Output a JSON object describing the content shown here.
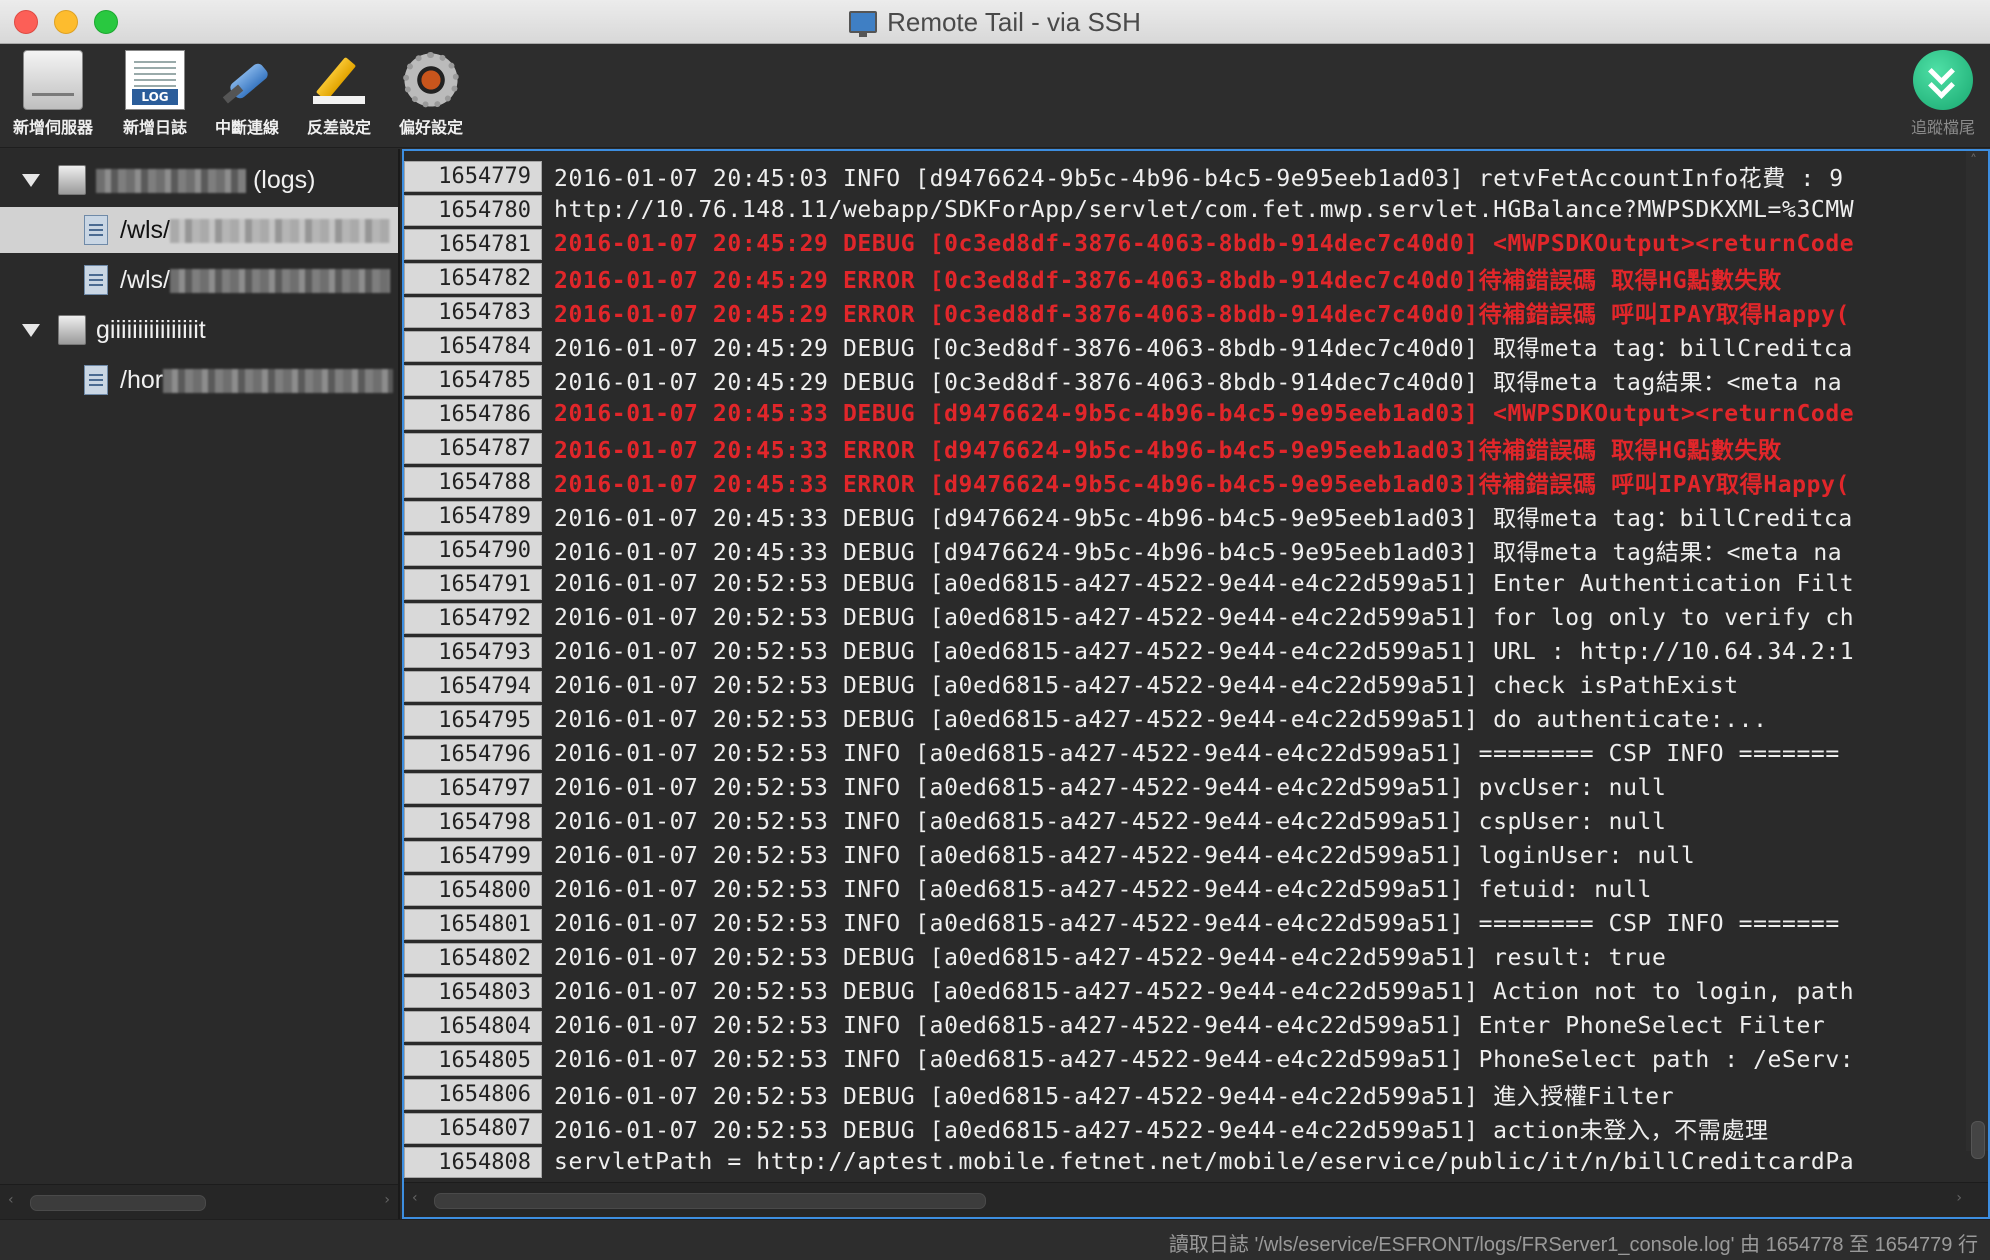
{
  "window": {
    "title": "Remote Tail - via SSH"
  },
  "toolbar": {
    "items": [
      {
        "label": "新增伺服器",
        "icon": "server-icon"
      },
      {
        "label": "新增日誌",
        "icon": "log-file-icon"
      },
      {
        "label": "中斷連線",
        "icon": "plug-disconnect-icon"
      },
      {
        "label": "反差設定",
        "icon": "highlighter-icon"
      },
      {
        "label": "偏好設定",
        "icon": "gear-icon"
      }
    ],
    "tail": {
      "label": "追蹤檔尾",
      "icon": "tail-down-icon"
    }
  },
  "sidebar": {
    "items": [
      {
        "type": "server",
        "text": " (logs)",
        "expanded": true
      },
      {
        "type": "log",
        "text": "/wls/",
        "selected": true
      },
      {
        "type": "log",
        "text": "/wls/"
      },
      {
        "type": "server",
        "text": "giiiiiiiiiiiiiiiit",
        "expanded": true
      },
      {
        "type": "log",
        "text": "/hor"
      }
    ]
  },
  "log": {
    "rows": [
      {
        "n": "1654779",
        "text": "2016-01-07 20:45:03 INFO [d9476624-9b5c-4b96-b4c5-9e95eeb1ad03] retvFetAccountInfo花費 : 9",
        "level": "info"
      },
      {
        "n": "1654780",
        "text": "http://10.76.148.11/webapp/SDKForApp/servlet/com.fet.mwp.servlet.HGBalance?MWPSDKXML=%3CMW",
        "level": "info"
      },
      {
        "n": "1654781",
        "text": "2016-01-07 20:45:29 DEBUG [0c3ed8df-3876-4063-8bdb-914dec7c40d0] <MWPSDKOutput><returnCode",
        "level": "error"
      },
      {
        "n": "1654782",
        "text": "2016-01-07 20:45:29 ERROR [0c3ed8df-3876-4063-8bdb-914dec7c40d0]待補錯誤碼 取得HG點數失敗",
        "level": "error"
      },
      {
        "n": "1654783",
        "text": "2016-01-07 20:45:29 ERROR [0c3ed8df-3876-4063-8bdb-914dec7c40d0]待補錯誤碼 呼叫IPAY取得Happy(",
        "level": "error"
      },
      {
        "n": "1654784",
        "text": "2016-01-07 20:45:29 DEBUG [0c3ed8df-3876-4063-8bdb-914dec7c40d0] 取得meta tag：billCreditca",
        "level": "info"
      },
      {
        "n": "1654785",
        "text": "2016-01-07 20:45:29 DEBUG [0c3ed8df-3876-4063-8bdb-914dec7c40d0] 取得meta tag結果：<meta na",
        "level": "info"
      },
      {
        "n": "1654786",
        "text": "2016-01-07 20:45:33 DEBUG [d9476624-9b5c-4b96-b4c5-9e95eeb1ad03] <MWPSDKOutput><returnCode",
        "level": "error"
      },
      {
        "n": "1654787",
        "text": "2016-01-07 20:45:33 ERROR [d9476624-9b5c-4b96-b4c5-9e95eeb1ad03]待補錯誤碼 取得HG點數失敗",
        "level": "error"
      },
      {
        "n": "1654788",
        "text": "2016-01-07 20:45:33 ERROR [d9476624-9b5c-4b96-b4c5-9e95eeb1ad03]待補錯誤碼 呼叫IPAY取得Happy(",
        "level": "error"
      },
      {
        "n": "1654789",
        "text": "2016-01-07 20:45:33 DEBUG [d9476624-9b5c-4b96-b4c5-9e95eeb1ad03] 取得meta tag：billCreditca",
        "level": "info"
      },
      {
        "n": "1654790",
        "text": "2016-01-07 20:45:33 DEBUG [d9476624-9b5c-4b96-b4c5-9e95eeb1ad03] 取得meta tag結果：<meta na",
        "level": "info"
      },
      {
        "n": "1654791",
        "text": "2016-01-07 20:52:53 DEBUG [a0ed6815-a427-4522-9e44-e4c22d599a51] Enter Authentication Filt",
        "level": "info"
      },
      {
        "n": "1654792",
        "text": "2016-01-07 20:52:53 DEBUG [a0ed6815-a427-4522-9e44-e4c22d599a51] for log only to verify ch",
        "level": "info"
      },
      {
        "n": "1654793",
        "text": "2016-01-07 20:52:53 DEBUG [a0ed6815-a427-4522-9e44-e4c22d599a51] URL : http://10.64.34.2:1",
        "level": "info"
      },
      {
        "n": "1654794",
        "text": "2016-01-07 20:52:53 DEBUG [a0ed6815-a427-4522-9e44-e4c22d599a51] check isPathExist",
        "level": "info"
      },
      {
        "n": "1654795",
        "text": "2016-01-07 20:52:53 DEBUG [a0ed6815-a427-4522-9e44-e4c22d599a51] do authenticate:...",
        "level": "info"
      },
      {
        "n": "1654796",
        "text": "2016-01-07 20:52:53 INFO [a0ed6815-a427-4522-9e44-e4c22d599a51] ======== CSP INFO =======",
        "level": "info"
      },
      {
        "n": "1654797",
        "text": "2016-01-07 20:52:53 INFO [a0ed6815-a427-4522-9e44-e4c22d599a51] pvcUser: null",
        "level": "info"
      },
      {
        "n": "1654798",
        "text": "2016-01-07 20:52:53 INFO [a0ed6815-a427-4522-9e44-e4c22d599a51] cspUser: null",
        "level": "info"
      },
      {
        "n": "1654799",
        "text": "2016-01-07 20:52:53 INFO [a0ed6815-a427-4522-9e44-e4c22d599a51] loginUser: null",
        "level": "info"
      },
      {
        "n": "1654800",
        "text": "2016-01-07 20:52:53 INFO [a0ed6815-a427-4522-9e44-e4c22d599a51] fetuid: null",
        "level": "info"
      },
      {
        "n": "1654801",
        "text": "2016-01-07 20:52:53 INFO [a0ed6815-a427-4522-9e44-e4c22d599a51] ======== CSP INFO =======",
        "level": "info"
      },
      {
        "n": "1654802",
        "text": "2016-01-07 20:52:53 DEBUG [a0ed6815-a427-4522-9e44-e4c22d599a51] result: true",
        "level": "info"
      },
      {
        "n": "1654803",
        "text": "2016-01-07 20:52:53 DEBUG [a0ed6815-a427-4522-9e44-e4c22d599a51] Action not to login, path",
        "level": "info"
      },
      {
        "n": "1654804",
        "text": "2016-01-07 20:52:53 INFO [a0ed6815-a427-4522-9e44-e4c22d599a51] Enter PhoneSelect Filter",
        "level": "info"
      },
      {
        "n": "1654805",
        "text": "2016-01-07 20:52:53 INFO [a0ed6815-a427-4522-9e44-e4c22d599a51] PhoneSelect path : /eServ:",
        "level": "info"
      },
      {
        "n": "1654806",
        "text": "2016-01-07 20:52:53 DEBUG [a0ed6815-a427-4522-9e44-e4c22d599a51] 進入授權Filter",
        "level": "info"
      },
      {
        "n": "1654807",
        "text": "2016-01-07 20:52:53 DEBUG [a0ed6815-a427-4522-9e44-e4c22d599a51] action未登入，不需處理",
        "level": "info"
      },
      {
        "n": "1654808",
        "text": "servletPath = http://aptest.mobile.fetnet.net/mobile/eservice/public/it/n/billCreditcardPa",
        "level": "info"
      }
    ]
  },
  "status": {
    "text": "讀取日誌 '/wls/eservice/ESFRONT/logs/FRServer1_console.log' 由 1654778 至 1654779 行"
  },
  "colors": {
    "error_text": "#e1262a",
    "selection_border": "#3d8ee0",
    "tail_button": "#18a870"
  }
}
